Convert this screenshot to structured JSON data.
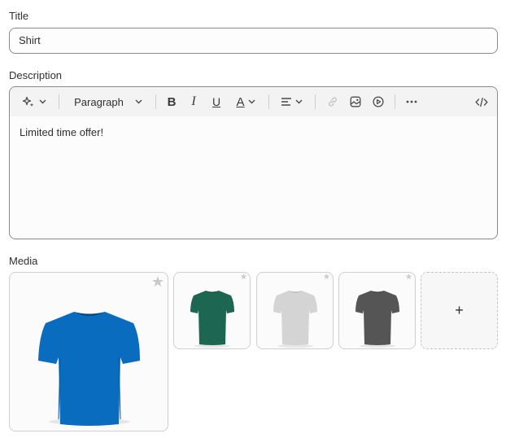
{
  "title_field": {
    "label": "Title",
    "value": "Shirt"
  },
  "description_field": {
    "label": "Description",
    "toolbar": {
      "ai_icon": "sparkle-icon",
      "block_format": "Paragraph",
      "bold": "B",
      "italic": "I",
      "underline": "U",
      "text_color": "A",
      "icons": [
        "sparkle-icon",
        "chevron-down-icon",
        "bold-icon",
        "italic-icon",
        "underline-icon",
        "text-color-icon",
        "align-left-icon",
        "link-icon",
        "image-icon",
        "video-icon",
        "more-icon",
        "code-icon"
      ]
    },
    "content": "Limited time offer!"
  },
  "media": {
    "label": "Media",
    "add_label": "+",
    "items": [
      {
        "name": "blue-shirt",
        "color": "#0a6cbf"
      },
      {
        "name": "green-shirt",
        "color": "#1d6651"
      },
      {
        "name": "gray-shirt",
        "color": "#d4d4d4"
      },
      {
        "name": "charcoal-shirt",
        "color": "#555556"
      }
    ]
  }
}
